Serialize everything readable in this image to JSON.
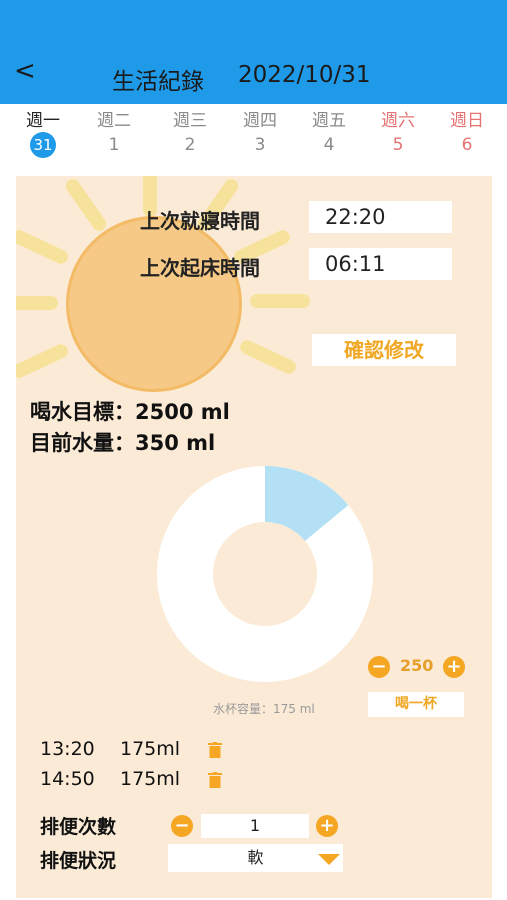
{
  "header": {
    "back_label": "<",
    "title": "生活紀錄",
    "date": "2022/10/31"
  },
  "week": [
    {
      "weekday": "週一",
      "day": "31",
      "active": true,
      "weekend": false
    },
    {
      "weekday": "週二",
      "day": "1",
      "active": false,
      "weekend": false
    },
    {
      "weekday": "週三",
      "day": "2",
      "active": false,
      "weekend": false
    },
    {
      "weekday": "週四",
      "day": "3",
      "active": false,
      "weekend": false
    },
    {
      "weekday": "週五",
      "day": "4",
      "active": false,
      "weekend": false
    },
    {
      "weekday": "週六",
      "day": "5",
      "active": false,
      "weekend": true
    },
    {
      "weekday": "週日",
      "day": "6",
      "active": false,
      "weekend": true
    }
  ],
  "sleep": {
    "last_sleep_label": "上次就寢時間",
    "last_sleep_value": "22:20",
    "last_wake_label": "上次起床時間",
    "last_wake_value": "06:11",
    "confirm_label": "確認修改"
  },
  "water": {
    "goal_text": "喝水目標：2500 ml",
    "current_text": "目前水量：350 ml",
    "goal_ml": 2500,
    "current_ml": 350,
    "progress_fraction": 0.14,
    "step_minus": "−",
    "step_value": "250",
    "step_plus": "+",
    "cup_capacity": "水杯容量：175 ml",
    "drink_button": "喝一杯",
    "log": [
      {
        "time": "13:20",
        "amount": "175ml"
      },
      {
        "time": "14:50",
        "amount": "175ml"
      }
    ]
  },
  "bowel": {
    "count_label": "排便次數",
    "count_minus": "−",
    "count_value": "1",
    "count_plus": "+",
    "status_label": "排便狀況",
    "status_value": "軟"
  },
  "colors": {
    "header_blue": "#1f9ae8",
    "panel_bg": "#fbebd6",
    "accent_orange": "#f5a623",
    "progress_blue": "#b3e0f5",
    "weekend_red": "#e57373"
  }
}
